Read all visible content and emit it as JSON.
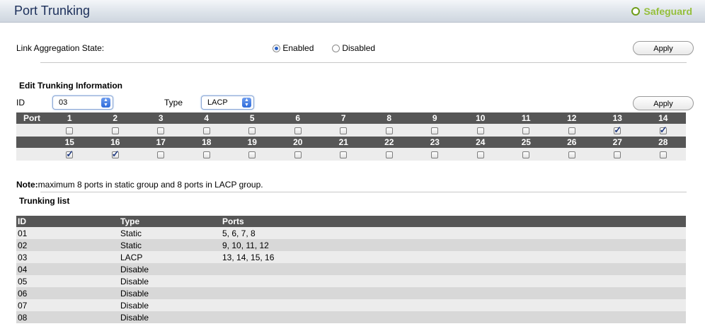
{
  "page": {
    "title": "Port Trunking",
    "safeguard_label": "Safeguard"
  },
  "link_aggregation": {
    "label": "Link Aggregation State:",
    "options": [
      "Enabled",
      "Disabled"
    ],
    "selected": "Enabled",
    "apply_label": "Apply"
  },
  "edit": {
    "heading": "Edit Trunking Information",
    "id_label": "ID",
    "id_value": "03",
    "type_label": "Type",
    "type_value": "LACP",
    "apply_label": "Apply",
    "port_header": "Port",
    "ports_row1": [
      "1",
      "2",
      "3",
      "4",
      "5",
      "6",
      "7",
      "8",
      "9",
      "10",
      "11",
      "12",
      "13",
      "14"
    ],
    "ports_row2": [
      "15",
      "16",
      "17",
      "18",
      "19",
      "20",
      "21",
      "22",
      "23",
      "24",
      "25",
      "26",
      "27",
      "28"
    ],
    "checked_row1": [
      false,
      false,
      false,
      false,
      false,
      false,
      false,
      false,
      false,
      false,
      false,
      false,
      true,
      true
    ],
    "checked_row2": [
      true,
      true,
      false,
      false,
      false,
      false,
      false,
      false,
      false,
      false,
      false,
      false,
      false,
      false
    ]
  },
  "note": {
    "bold": "Note:",
    "text": "maximum 8 ports in static group and 8 ports in LACP group."
  },
  "trunking_list": {
    "heading": "Trunking list",
    "columns": [
      "ID",
      "Type",
      "Ports"
    ],
    "rows": [
      {
        "id": "01",
        "type": "Static",
        "ports": "5, 6, 7, 8"
      },
      {
        "id": "02",
        "type": "Static",
        "ports": "9, 10, 11, 12"
      },
      {
        "id": "03",
        "type": "LACP",
        "ports": "13, 14, 15, 16"
      },
      {
        "id": "04",
        "type": "Disable",
        "ports": ""
      },
      {
        "id": "05",
        "type": "Disable",
        "ports": ""
      },
      {
        "id": "06",
        "type": "Disable",
        "ports": ""
      },
      {
        "id": "07",
        "type": "Disable",
        "ports": ""
      },
      {
        "id": "08",
        "type": "Disable",
        "ports": ""
      }
    ]
  }
}
